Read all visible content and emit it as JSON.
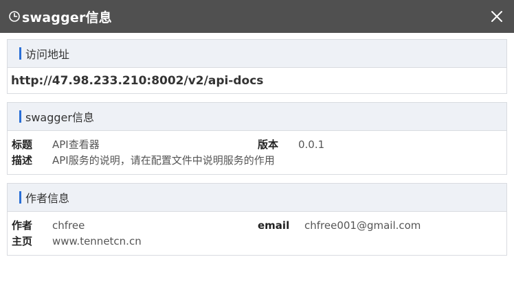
{
  "window": {
    "title": "swagger信息",
    "icon": "clock-icon",
    "close_icon": "close-icon"
  },
  "access": {
    "header": "访问地址",
    "url": "http://47.98.233.210:8002/v2/api-docs"
  },
  "swagger": {
    "header": "swagger信息",
    "title_label": "标题",
    "title_value": "API查看器",
    "version_label": "版本",
    "version_value": "0.0.1",
    "desc_label": "描述",
    "desc_value": "API服务的说明，请在配置文件中说明服务的作用"
  },
  "author": {
    "header": "作者信息",
    "name_label": "作者",
    "name_value": "chfree",
    "email_label": "email",
    "email_value": "chfree001@gmail.com",
    "homepage_label": "主页",
    "homepage_value": "www.tennetcn.cn"
  },
  "colors": {
    "titlebar": "#505050",
    "accent": "#2a6fd6",
    "section_header_bg": "#eef1f6"
  }
}
